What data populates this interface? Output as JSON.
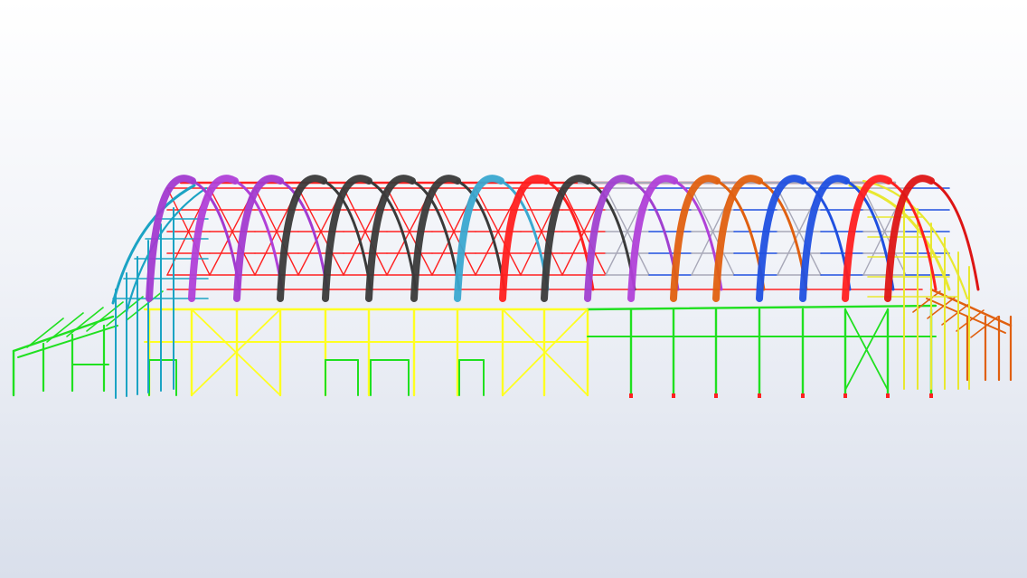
{
  "viewport": {
    "background_top": "#ffffff",
    "background_bottom": "#d9dfeb"
  },
  "model": {
    "colors": {
      "roof_bracing": "#ff2020",
      "roof_bracing_east": "#a8a8b8",
      "purlins_east": "#2050e0",
      "wall_bracing": "#ffff20",
      "wall_frame": "#20e020",
      "annex_left": "#20e020",
      "annex_right": "#e06010",
      "gable_left": "#1ba3c4",
      "gable_right": "#e8e830",
      "column_base": "#ff2020"
    },
    "arches": [
      {
        "id": "arch-1",
        "color": "#a23ad0"
      },
      {
        "id": "arch-2",
        "color": "#b040d8"
      },
      {
        "id": "arch-3",
        "color": "#a23ad0"
      },
      {
        "id": "arch-4",
        "color": "#3a3a3a"
      },
      {
        "id": "arch-5",
        "color": "#3a3a3a"
      },
      {
        "id": "arch-6",
        "color": "#3a3a3a"
      },
      {
        "id": "arch-7",
        "color": "#3a3a3a"
      },
      {
        "id": "arch-8",
        "color": "#3aa8d0"
      },
      {
        "id": "arch-9",
        "color": "#ff2020"
      },
      {
        "id": "arch-10",
        "color": "#3a3a3a"
      },
      {
        "id": "arch-11",
        "color": "#a040d0"
      },
      {
        "id": "arch-12",
        "color": "#b040d8"
      },
      {
        "id": "arch-13",
        "color": "#e06010"
      },
      {
        "id": "arch-14",
        "color": "#e06010"
      },
      {
        "id": "arch-15",
        "color": "#2050e0"
      },
      {
        "id": "arch-16",
        "color": "#2050e0"
      },
      {
        "id": "arch-17",
        "color": "#ff2020"
      },
      {
        "id": "arch-18",
        "color": "#dd1515"
      }
    ]
  }
}
